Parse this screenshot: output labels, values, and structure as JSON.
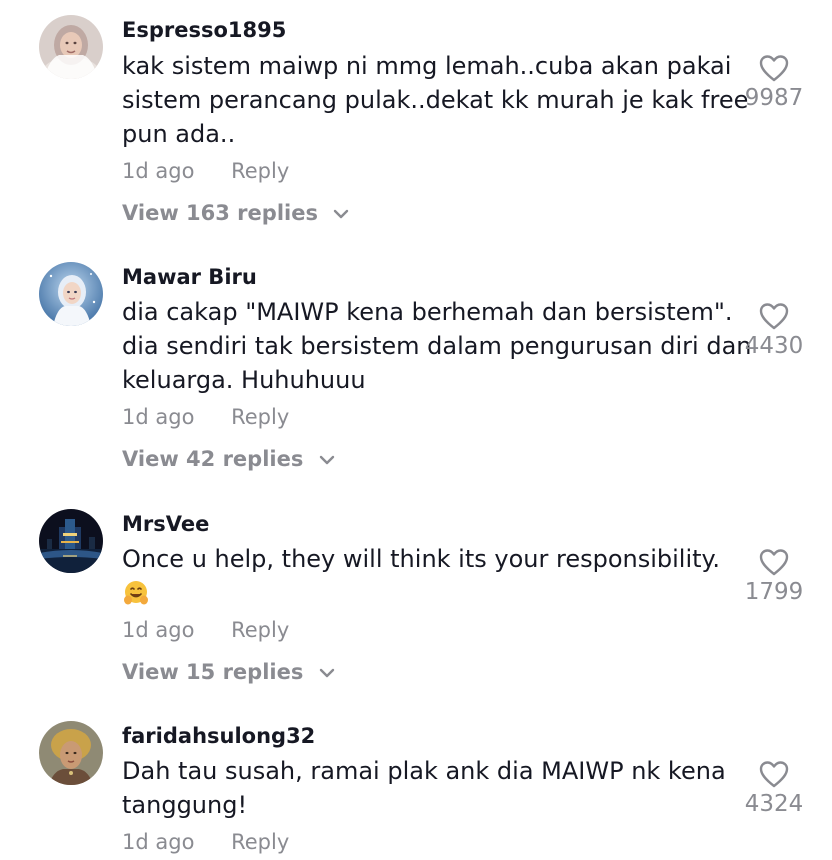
{
  "comments": [
    {
      "username": "Espresso1895",
      "lines": [
        "kak sistem maiwp ni mmg lemah..cuba akan pakai",
        "sistem perancang pulak..dekat kk murah je kak free",
        "pun ada.."
      ],
      "time": "1d ago",
      "reply_label": "Reply",
      "replies_label": "View 163 replies",
      "likes": "9987",
      "avatar_icon": "avatar-hijab-woman-icon"
    },
    {
      "username": "Mawar Biru",
      "lines": [
        "dia cakap \"MAIWP kena berhemah dan bersistem\".",
        "dia sendiri tak bersistem dalam pengurusan diri dan",
        "keluarga. Huhuhuuu"
      ],
      "time": "1d ago",
      "reply_label": "Reply",
      "replies_label": "View 42 replies",
      "likes": "4430",
      "avatar_icon": "avatar-blue-hijab-illustration-icon"
    },
    {
      "username": "MrsVee",
      "lines": [
        "Once u help, they will think its your responsibility."
      ],
      "emoji": "hugging-face-emoji",
      "time": "1d ago",
      "reply_label": "Reply",
      "replies_label": "View 15 replies",
      "likes": "1799",
      "avatar_icon": "avatar-night-city-icon"
    },
    {
      "username": "faridahsulong32",
      "lines": [
        "Dah tau susah, ramai plak ank dia MAIWP nk kena",
        "tanggung!"
      ],
      "time": "1d ago",
      "reply_label": "Reply",
      "likes": "4324",
      "avatar_icon": "avatar-headscarf-portrait-icon"
    }
  ],
  "colors": {
    "text": "#161823",
    "muted": "#8a8b91",
    "background": "#ffffff"
  }
}
